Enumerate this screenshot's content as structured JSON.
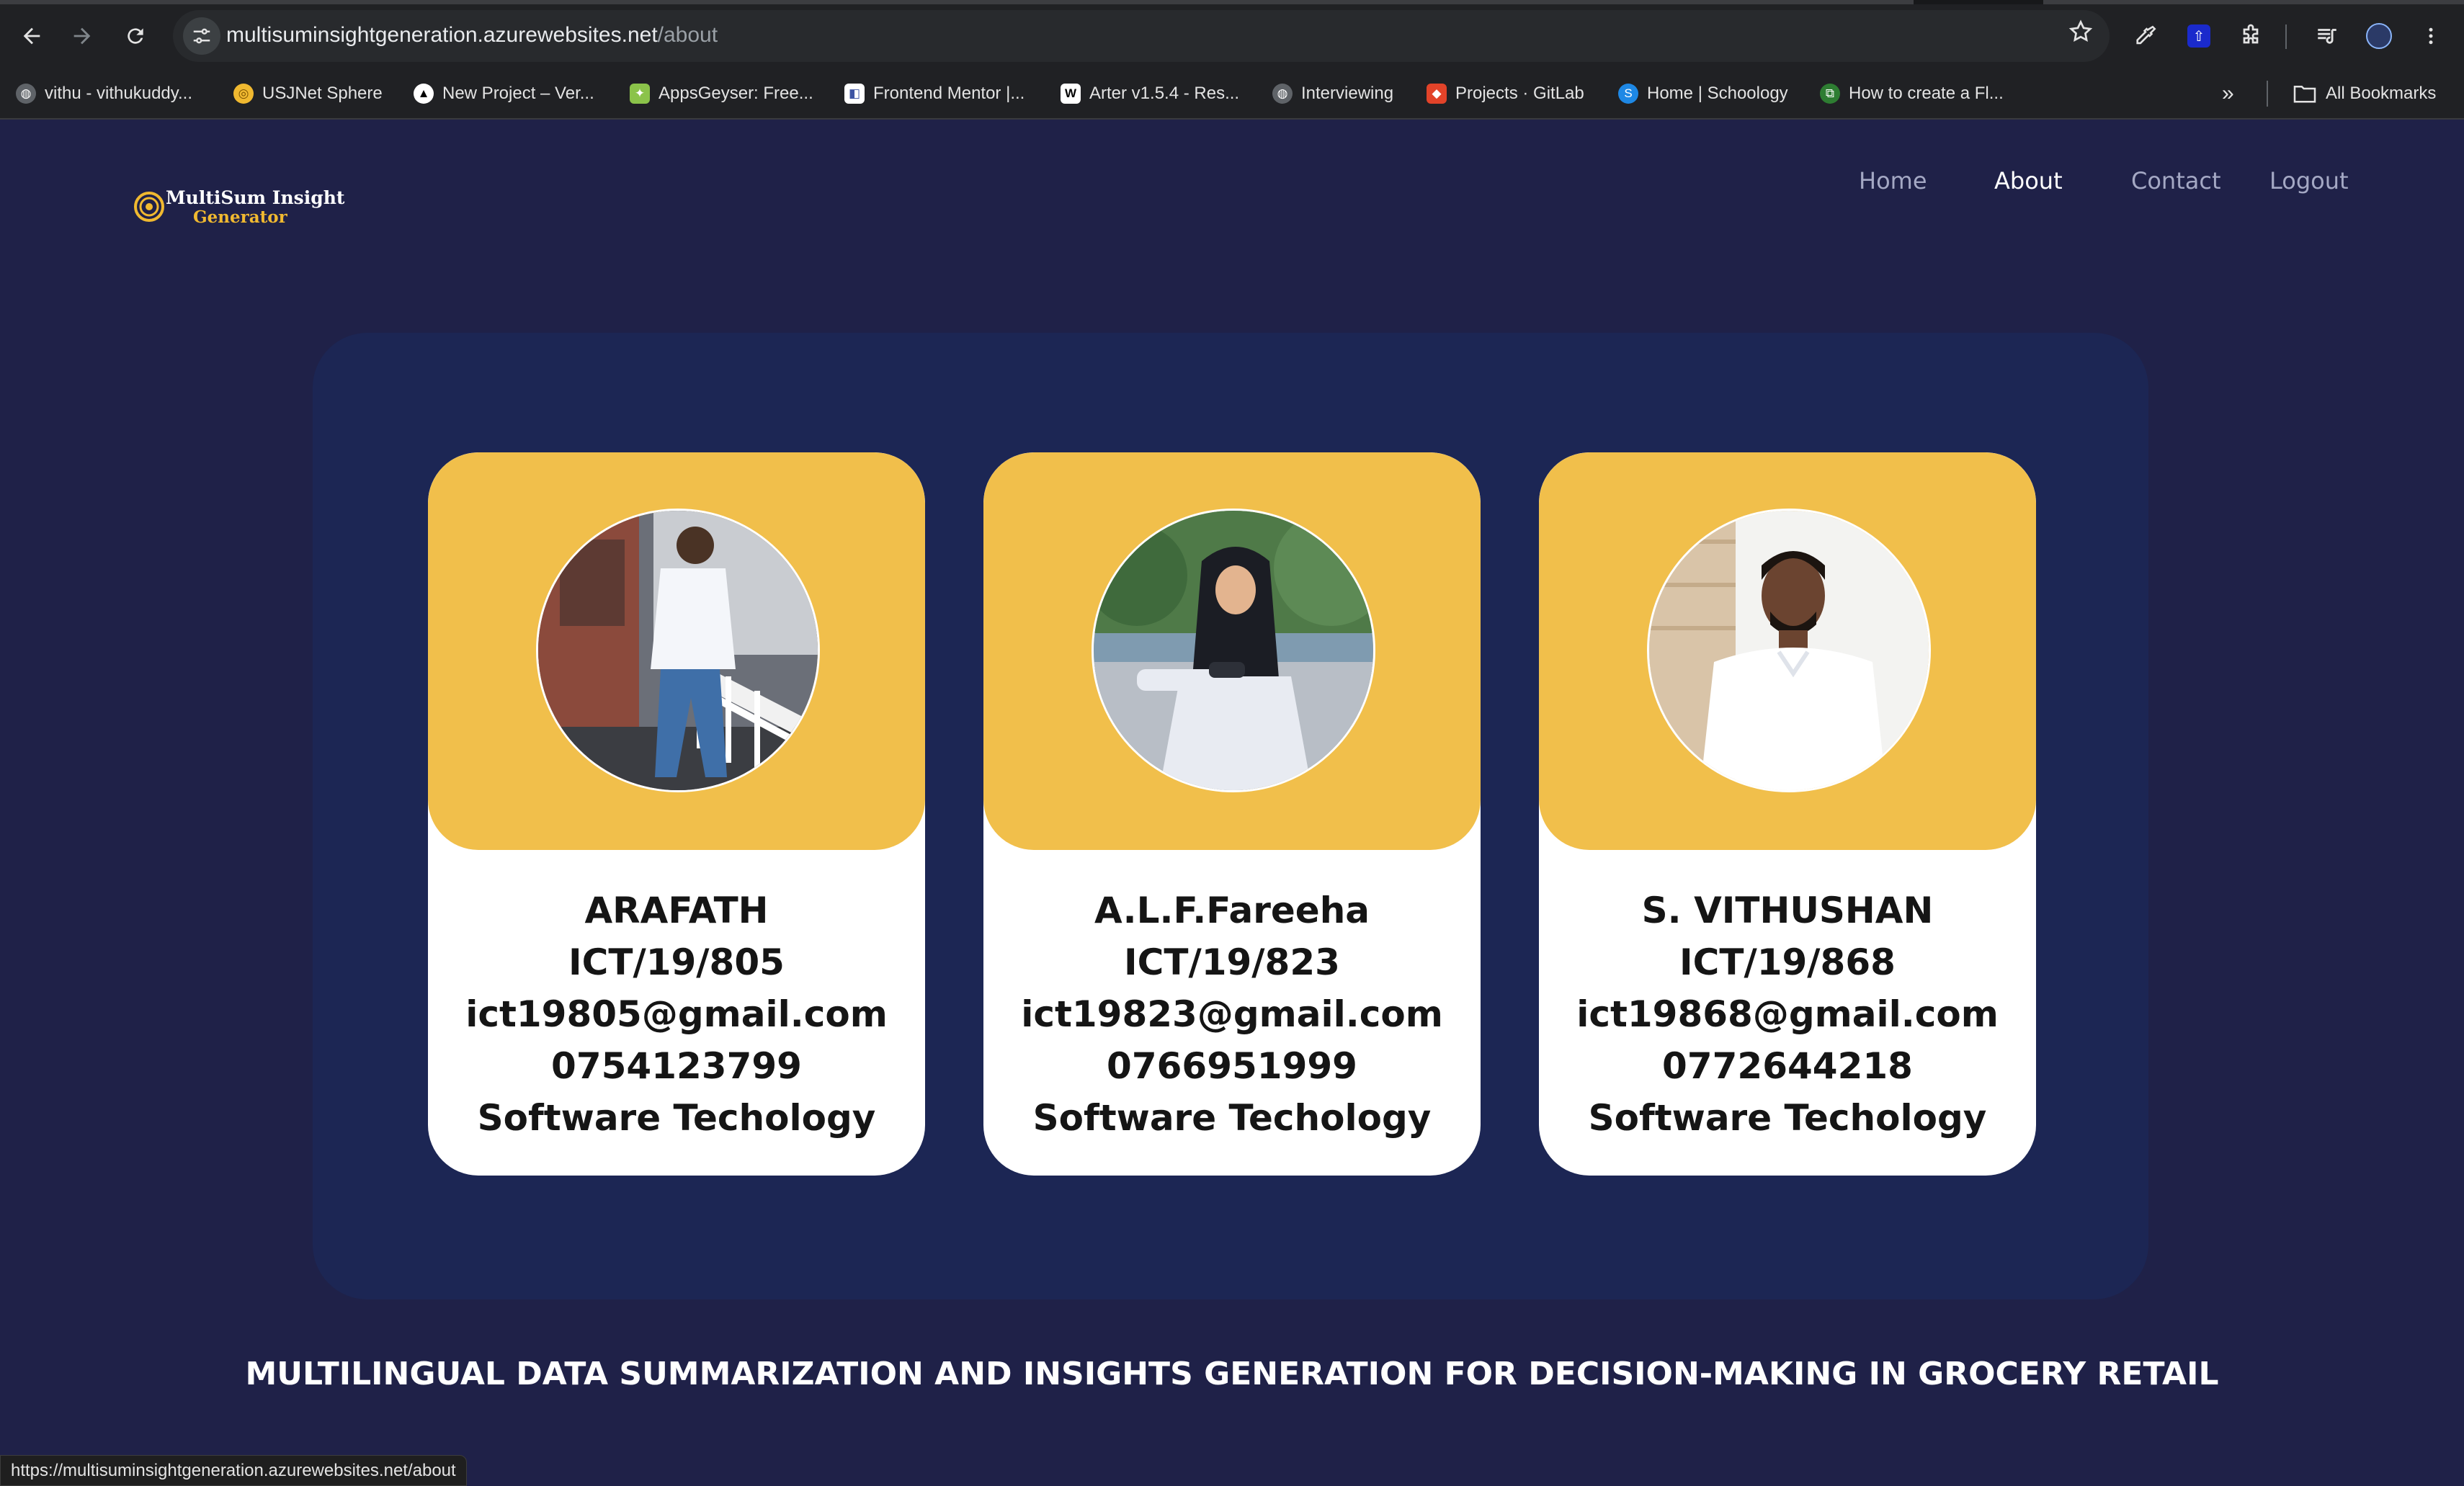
{
  "browser": {
    "url_host": "multisuminsightgeneration.azurewebsites.net",
    "url_path": "/about",
    "bookmarks": [
      {
        "label": "vithu - vithukuddy...",
        "icon": "globe-icon",
        "color": "#5f6368"
      },
      {
        "label": "USJNet Sphere",
        "icon": "sphere-icon",
        "color": "#f0b930"
      },
      {
        "label": "New Project – Ver...",
        "icon": "vercel-icon",
        "color": "#000000"
      },
      {
        "label": "AppsGeyser: Free...",
        "icon": "appsgeyser-icon",
        "color": "#8bc34a"
      },
      {
        "label": "Frontend Mentor |...",
        "icon": "frontend-mentor-icon",
        "color": "#ffffff"
      },
      {
        "label": "Arter v1.5.4 - Res...",
        "icon": "arter-icon",
        "color": "#ffffff"
      },
      {
        "label": "Interviewing",
        "icon": "globe-icon",
        "color": "#5f6368"
      },
      {
        "label": "Projects · GitLab",
        "icon": "gitlab-icon",
        "color": "#e24329"
      },
      {
        "label": "Home | Schoology",
        "icon": "schoology-icon",
        "color": "#1e88e5"
      },
      {
        "label": "How to create a Fl...",
        "icon": "flutter-icon",
        "color": "#2e7d32"
      }
    ],
    "all_bookmarks_label": "All Bookmarks",
    "status_url": "https://multisuminsightgeneration.azurewebsites.net/about"
  },
  "site": {
    "logo_line1": "MultiSum Insight",
    "logo_line2": "Generator",
    "nav": [
      {
        "label": "Home"
      },
      {
        "label": "About"
      },
      {
        "label": "Contact"
      },
      {
        "label": "Logout"
      }
    ],
    "active_nav": "About"
  },
  "team": [
    {
      "name": "ARAFATH",
      "id": "ICT/19/805",
      "email": "ict19805@gmail.com",
      "phone": "0754123799",
      "dept": "Software Techology"
    },
    {
      "name": "A.L.F.Fareeha",
      "id": "ICT/19/823",
      "email": "ict19823@gmail.com",
      "phone": "0766951999",
      "dept": "Software Techology"
    },
    {
      "name": "S. VITHUSHAN",
      "id": "ICT/19/868",
      "email": "ict19868@gmail.com",
      "phone": "0772644218",
      "dept": "Software Techology"
    }
  ],
  "project_title": "MULTILINGUAL DATA SUMMARIZATION AND INSIGHTS GENERATION FOR DECISION-MAKING IN GROCERY RETAIL",
  "colors": {
    "page_bg": "#1f2148",
    "panel_bg": "#1c2654",
    "card_accent": "#f1bf4b",
    "card_bg": "#ffffff",
    "logo_accent": "#f0b930"
  }
}
